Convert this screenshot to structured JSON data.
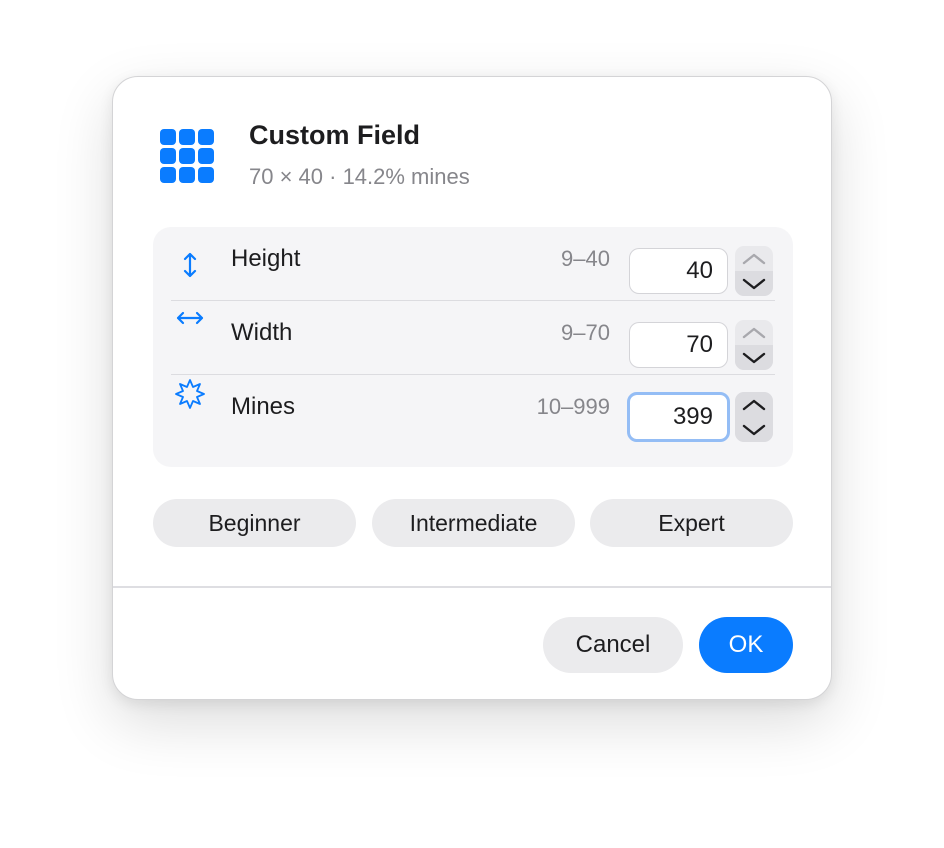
{
  "dialog": {
    "title": "Custom Field",
    "subtitle": "70 × 40 · 14.2% mines",
    "icon": "grid-icon",
    "accent_color": "#0A7CFF"
  },
  "fields": [
    {
      "label": "Height",
      "range": "9–40",
      "value": "40",
      "icon": "vertical-arrows-icon"
    },
    {
      "label": "Width",
      "range": "9–70",
      "value": "70",
      "icon": "horizontal-arrows-icon"
    },
    {
      "label": "Mines",
      "range": "10–999",
      "value": "399",
      "icon": "starburst-icon",
      "focused": true
    }
  ],
  "presets": [
    "Beginner",
    "Intermediate",
    "Expert"
  ],
  "actions": {
    "cancel_label": "Cancel",
    "ok_label": "OK"
  }
}
